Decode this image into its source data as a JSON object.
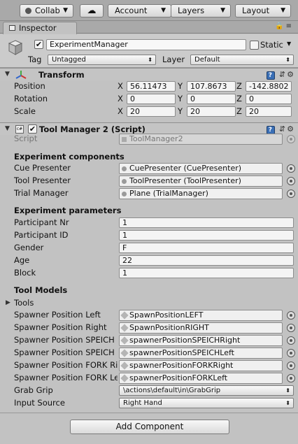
{
  "toolbar": {
    "collab": "Collab",
    "account": "Account",
    "layers": "Layers",
    "layout": "Layout"
  },
  "tab": {
    "label": "Inspector"
  },
  "object": {
    "name": "ExperimentManager",
    "active": true,
    "static_label": "Static",
    "tag_label": "Tag",
    "tag_value": "Untagged",
    "layer_label": "Layer",
    "layer_value": "Default"
  },
  "transform": {
    "title": "Transform",
    "rows": [
      {
        "label": "Position",
        "x": "56.11473",
        "y": "107.8673",
        "z": "-142.8802"
      },
      {
        "label": "Rotation",
        "x": "0",
        "y": "0",
        "z": "0"
      },
      {
        "label": "Scale",
        "x": "20",
        "y": "20",
        "z": "20"
      }
    ],
    "axis": {
      "x": "X",
      "y": "Y",
      "z": "Z"
    }
  },
  "script_component": {
    "title": "Tool Manager 2 (Script)",
    "script_label": "Script",
    "script_value": "ToolManager2",
    "components_header": "Experiment components",
    "components": [
      {
        "label": "Cue Presenter",
        "value": "CuePresenter (CuePresenter)"
      },
      {
        "label": "Tool Presenter",
        "value": "ToolPresenter (ToolPresenter)"
      },
      {
        "label": "Trial Manager",
        "value": "Plane (TrialManager)"
      }
    ],
    "params_header": "Experiment parameters",
    "params": [
      {
        "label": "Participant Nr",
        "value": "1"
      },
      {
        "label": "Participant ID",
        "value": "1"
      },
      {
        "label": "Gender",
        "value": "F"
      },
      {
        "label": "Age",
        "value": "22"
      },
      {
        "label": "Block",
        "value": "1"
      }
    ],
    "models_header": "Tool Models",
    "tools_label": "Tools",
    "spawners": [
      {
        "label": "Spawner Position Left",
        "value": "SpawnPositionLEFT"
      },
      {
        "label": "Spawner Position Right",
        "value": "SpawnPositionRIGHT"
      },
      {
        "label": "Spawner Position SPEICH",
        "value": "spawnerPositionSPEICHRight"
      },
      {
        "label": "Spawner Position SPEICH",
        "value": "spawnerPositionSPEICHLeft"
      },
      {
        "label": "Spawner Position FORK Ri",
        "value": "spawnerPositionFORKRight"
      },
      {
        "label": "Spawner Position FORK Le",
        "value": "spawnerPositionFORKLeft"
      }
    ],
    "grab_grip_label": "Grab Grip",
    "grab_grip_value": "\\actions\\default\\in\\GrabGrip",
    "input_source_label": "Input Source",
    "input_source_value": "Right Hand"
  },
  "add_component": "Add Component"
}
